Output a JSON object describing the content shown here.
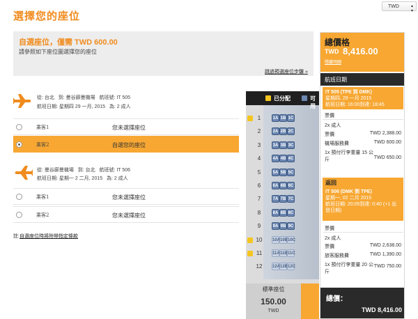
{
  "page": {
    "title": "選擇您的座位"
  },
  "currency": {
    "selected": "TWD"
  },
  "info": {
    "title": "自選座位，僅需 TWD 600.00",
    "subtitle": "請參照如下座位圖選擇您的座位",
    "skip_link": "跳過預選座位步驟 »"
  },
  "flights": [
    {
      "from": "從: 台北",
      "to": "到: 曼谷廊曼機場",
      "flight_no": "航班號: IT 505",
      "date": "航班日期: 星期四 29 一月, 2015",
      "pax_count": "為: 2 成人",
      "passengers": [
        {
          "name": "乘客1",
          "status": "您未選擇座位",
          "selected": false
        },
        {
          "name": "乘客2",
          "status": "自選您的座位",
          "selected": true
        }
      ]
    },
    {
      "from": "從: 曼谷廊曼機場",
      "to": "到: 台北",
      "flight_no": "航班號: IT 506",
      "date": "航班日期: 星期一 2 二月, 2015",
      "pax_count": "為: 2 成人",
      "passengers": [
        {
          "name": "乘客1",
          "status": "您未選擇座位",
          "selected": false
        },
        {
          "name": "乘客2",
          "status": "您未選擇座位",
          "selected": false
        }
      ]
    }
  ],
  "terms": {
    "prefix": "註:",
    "link": "自選座位時將附帶指定條款"
  },
  "seatmap": {
    "legend": [
      {
        "label": "已分配",
        "color": "#f4c51e"
      },
      {
        "label": "可用",
        "color": "#6b86b0"
      }
    ],
    "rows": [
      "1",
      "2",
      "3",
      "4",
      "5",
      "6",
      "7",
      "8",
      "9",
      "10",
      "11",
      "12"
    ],
    "seat_labels": [
      [
        "1A",
        "1B",
        "1C"
      ],
      [
        "2A",
        "2B",
        "2C"
      ],
      [
        "3A",
        "3B",
        "3C"
      ],
      [
        "4A",
        "4B",
        "4C"
      ],
      [
        "5A",
        "5B",
        "5C"
      ],
      [
        "6A",
        "6B",
        "6C"
      ],
      [
        "7A",
        "7B",
        "7C"
      ],
      [
        "8A",
        "8B",
        "8C"
      ],
      [
        "9A",
        "9B",
        "9C"
      ],
      [
        "10A",
        "10B",
        "10C"
      ],
      [
        "11A",
        "11B",
        "11C"
      ],
      [
        "12A",
        "12B",
        "12C"
      ]
    ],
    "category": {
      "label": "標準座位",
      "price": "150.00",
      "currency": "TWD"
    }
  },
  "summary": {
    "title": "總價格",
    "currency": "TWD",
    "total": "8,416.00",
    "hide_link": "隱藏明細",
    "section_title": "航班日期",
    "outbound": {
      "line1": "IT 505 (TPE 到 DMK)",
      "line2": "星期四, 29 一月 2015",
      "line3": "航班日期: 16:00到達: 18:45",
      "fare_title": "票價",
      "pax": "2x 成人",
      "items": [
        {
          "label": "票價",
          "amount": "TWD 2,388.00"
        },
        {
          "label": "機場服務費",
          "amount": "TWD 600.00"
        },
        {
          "label": "1x 預付行李重量 15 公斤",
          "amount": "TWD 650.00"
        }
      ]
    },
    "return_title": "返回",
    "inbound": {
      "line1": "IT 506 (DMK 到 TPE)",
      "line2": "星期一, 02 二月 2015",
      "line3": "航班日期: 20:05到達: 0:40 (+1 出發日期)",
      "fare_title": "票價",
      "pax": "2x 成人",
      "items": [
        {
          "label": "票價",
          "amount": "TWD 2,638.00"
        },
        {
          "label": "旅客服務費",
          "amount": "TWD 1,390.00"
        },
        {
          "label": "1x 預付行李重量 20 公斤",
          "amount": "TWD 750.00"
        }
      ]
    },
    "grand_label": "總價：",
    "grand_total": "TWD 8,416.00"
  }
}
